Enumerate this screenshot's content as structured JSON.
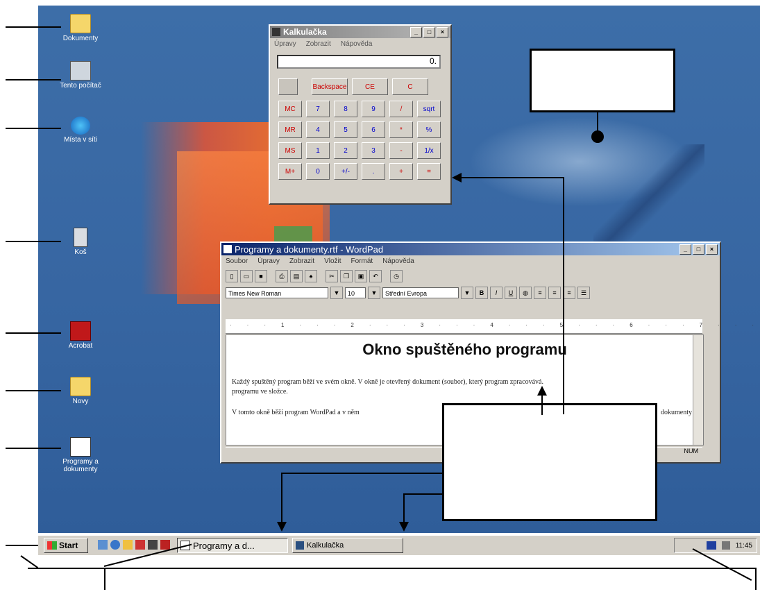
{
  "desktop": {
    "icons": [
      {
        "label": "Dokumenty"
      },
      {
        "label": "Tento počítač"
      },
      {
        "label": "Místa v síti"
      },
      {
        "label": "Koš"
      },
      {
        "label": "Acrobat"
      },
      {
        "label": "Novy"
      },
      {
        "label": "Programy a dokumenty"
      }
    ]
  },
  "calculator": {
    "title": "Kalkulačka",
    "menu": [
      "Úpravy",
      "Zobrazit",
      "Nápověda"
    ],
    "display": "0.",
    "buttons": [
      "Backspace",
      "CE",
      "C",
      "MC",
      "7",
      "8",
      "9",
      "/",
      "sqrt",
      "MR",
      "4",
      "5",
      "6",
      "*",
      "%",
      "MS",
      "1",
      "2",
      "3",
      "-",
      "1/x",
      "M+",
      "0",
      "+/-",
      ".",
      "+",
      "="
    ]
  },
  "wordpad": {
    "title": "Programy a dokumenty.rtf - WordPad",
    "menu": [
      "Soubor",
      "Úpravy",
      "Zobrazit",
      "Vložit",
      "Formát",
      "Nápověda"
    ],
    "font": "Times New Roman",
    "size": "10",
    "script": "Střední Evropa",
    "heading": "Okno spuštěného programu",
    "para1": "Každý spuštěný program běží ve svém okně. V okně je otevřený dokument (soubor), který program zpracovává.",
    "para1b": "programu ve složce.",
    "para2": "V tomto okně běží program WordPad a v něm",
    "para2b": "dokumenty",
    "status": "NUM"
  },
  "taskbar": {
    "start": "Start",
    "tasks": [
      {
        "label": "Programy a d..."
      },
      {
        "label": "Kalkulačka"
      }
    ],
    "clock": "11:45"
  },
  "colors": {
    "desktop": "#3766a2",
    "window_face": "#d4d0c8",
    "title_active": "#0a246a",
    "title_inactive": "#808080"
  }
}
